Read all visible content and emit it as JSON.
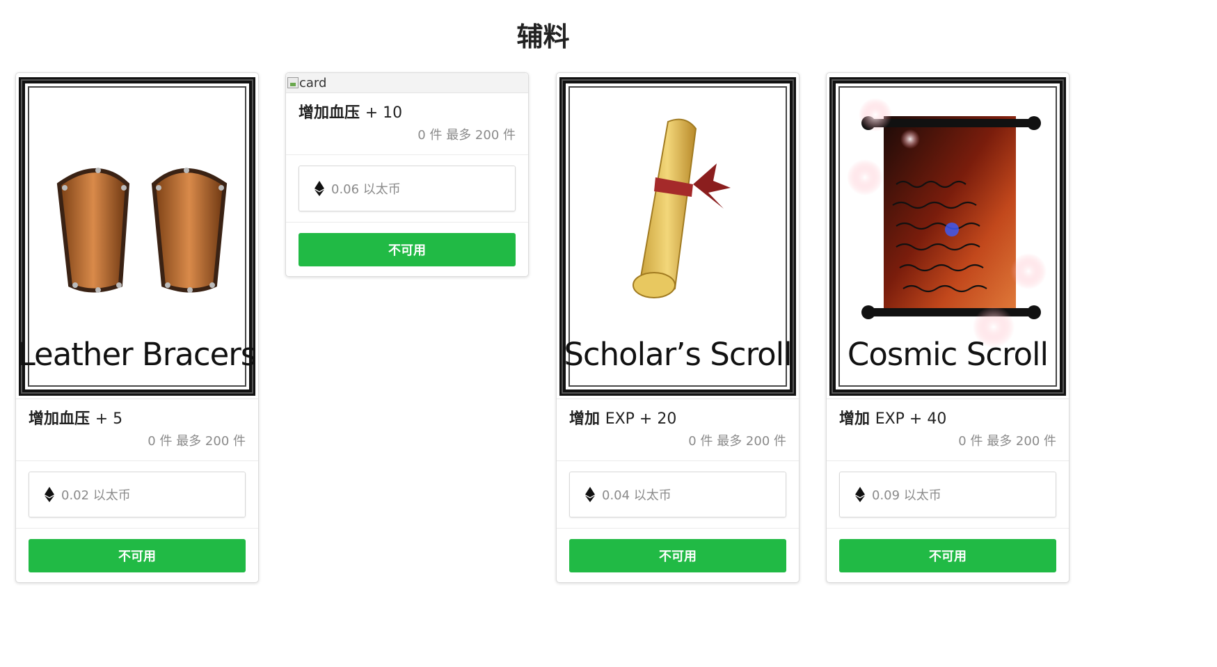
{
  "page": {
    "title": "辅料"
  },
  "cards": [
    {
      "image_label": "Leather Bracers",
      "image_icon": "leather-bracers-icon",
      "effect_prefix": "增加血压",
      "effect_value": "+ 5",
      "stock": "0 件 最多 200 件",
      "price": "0.02 以太币",
      "button": "不可用"
    },
    {
      "image_alt": "card",
      "image_icon": "broken-image-icon",
      "effect_prefix": "增加血压",
      "effect_value": "+ 10",
      "stock": "0 件 最多 200 件",
      "price": "0.06 以太币",
      "button": "不可用"
    },
    {
      "image_label": "Scholar’s Scroll",
      "image_icon": "scholars-scroll-icon",
      "effect_prefix": "增加",
      "effect_value": "EXP + 20",
      "stock": "0 件 最多 200 件",
      "price": "0.04 以太币",
      "button": "不可用"
    },
    {
      "image_label": "Cosmic Scroll",
      "image_icon": "cosmic-scroll-icon",
      "effect_prefix": "增加",
      "effect_value": "EXP + 40",
      "stock": "0 件 最多 200 件",
      "price": "0.09 以太币",
      "button": "不可用"
    }
  ],
  "colors": {
    "button": "#21ba45",
    "button_text": "#ffffff",
    "muted_text": "#8a8a8a"
  },
  "icons": {
    "currency": "ethereum-icon"
  }
}
